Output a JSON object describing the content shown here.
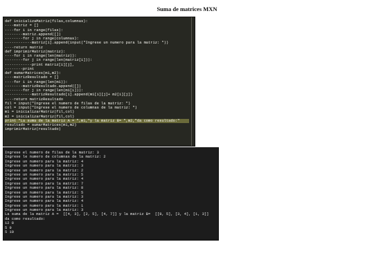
{
  "page": {
    "title": "Suma de matrices MXN"
  },
  "editor": {
    "lines": [
      "def inicializaMatriz(filas,columnas):",
      "····matriz = []",
      "····for i in range(filas):",
      "········matriz.append([])",
      "········for j in range(columnas):",
      "············matriz[i].append(input(\"Ingrese un numero para la matriz: \"))",
      "····return matriz",
      "def imprimirMatriz(matriz):",
      "····for i in range(len(matriz)):",
      "········for j in range(len(matriz[i])):",
      "············print matriz[i][j],",
      "········print",
      "def sumarMatrices(m1,m2):",
      "····matrizResultado = []",
      "····for i in range(len(m1)):",
      "········matrizResultado.append([])",
      "········for j in range(len(m1[i])):",
      "············matrizResultado[i].append(m1[i][j]+ m2[i][j])",
      "····return matrizResultado",
      "fil = input(\"Ingrese el numero de filas de la matriz: \")",
      "col = input(\"Ingrese el numero de columnas de la matriz: \")",
      "m1 = inicializarMatriz(fil,col)",
      "m2 = inicializarMatriz(fil,col)",
      "print \"La suma de la matriz A = \",m1,\"y la matriz B= \",m2,\"da como resultado:\"",
      "resultado = sumarMatrices(m1,m2)",
      "imprimirMatriz(resultado)"
    ],
    "highlighted_line": 23
  },
  "terminal": {
    "lines": [
      "Ingrese el numero de filas de la matriz: 3",
      "Ingrese le numero de columnas de la matriz: 2",
      "Ingrese un numero para la matriz: 4",
      "Ingrese un numero para la matriz: 3",
      "Ingrese un numero para la matriz: 2",
      "Ingrese un numero para la matriz: 5",
      "Ingrese un numero para la matriz: 4",
      "Ingrese un numero para la matriz: 7",
      "Ingrese un numero para la matriz: 8",
      "Ingrese un numero para la matriz: 5",
      "Ingrese un numero para la matriz: 3",
      "Ingrese un numero para la matriz: 4",
      "Ingrese un numero para la matriz: 1",
      "Ingrese un numero para la matriz: 3",
      "La suma de la matriz A =  [[4, 3], [2, 5], [4, 7]] y la matriz B=  [[8, 5], [3, 4], [1, 3]]",
      "da como resultado:",
      "12 8",
      "5 9",
      "5 10"
    ]
  }
}
